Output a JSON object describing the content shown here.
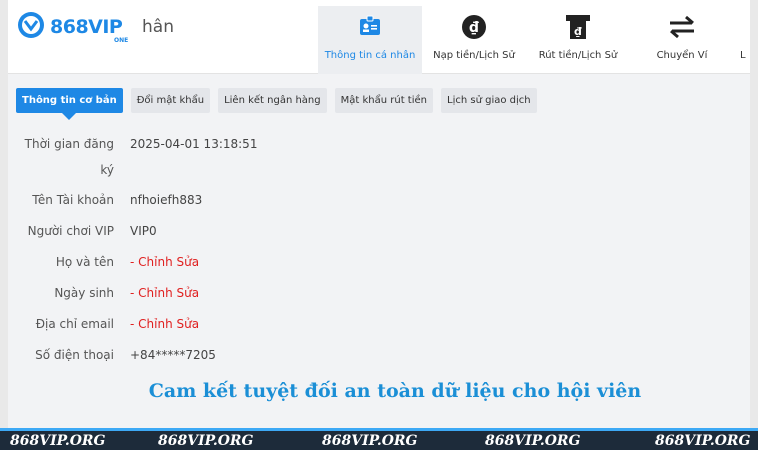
{
  "header": {
    "logo_text": "868VIP",
    "logo_sub": "ONE",
    "username": "hân",
    "nav": [
      {
        "label": "Thông tin cá nhân",
        "icon": "id-card-icon",
        "active": true
      },
      {
        "label": "Nạp tiền/Lịch Sử",
        "icon": "dong-coin-icon",
        "active": false
      },
      {
        "label": "Rút tiền/Lịch Sử",
        "icon": "atm-withdraw-icon",
        "active": false
      },
      {
        "label": "Chuyển Ví",
        "icon": "transfer-arrows-icon",
        "active": false
      },
      {
        "label": "L",
        "icon": "",
        "active": false
      }
    ]
  },
  "tabs": [
    {
      "label": "Thông tin cơ bản",
      "active": true
    },
    {
      "label": "Đổi mật khẩu",
      "active": false
    },
    {
      "label": "Liên kết ngân hàng",
      "active": false
    },
    {
      "label": "Mật khẩu rút tiền",
      "active": false
    },
    {
      "label": "Lịch sử giao dịch",
      "active": false
    }
  ],
  "profile": {
    "reg_time_label_1": "Thời gian đăng",
    "reg_time_label_2": "ký",
    "reg_time_value": "2025-04-01 13:18:51",
    "account_label": "Tên Tài khoản",
    "account_value": "nfhoiefh883",
    "vip_label": "Người chơi VIP",
    "vip_value": "VIP0",
    "name_label": "Họ và tên",
    "name_value": "- Chỉnh Sửa",
    "birth_label": "Ngày sinh",
    "birth_value": "- Chỉnh Sửa",
    "email_label": "Địa chỉ email",
    "email_value": "- Chỉnh Sửa",
    "phone_label": "Số điện thoại",
    "phone_value": "+84*****7205"
  },
  "banner": "Cam kết tuyệt đối an toàn dữ liệu cho hội viên",
  "watermark": "868VIP.ORG",
  "colors": {
    "accent": "#1e88e5",
    "edit": "#e02020",
    "footer": "#1d2b3a"
  }
}
